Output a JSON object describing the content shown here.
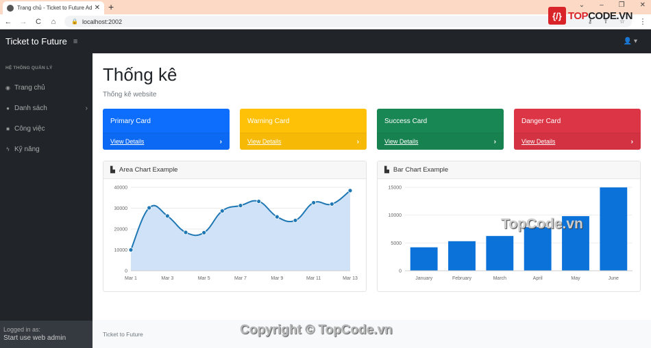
{
  "browser": {
    "tab_title": "Trang chủ - Ticket to Future Admin",
    "url": "localhost:2002",
    "nav": {
      "back": "←",
      "forward": "→",
      "reload": "C",
      "home": "⌂"
    },
    "window_controls": [
      "⌄",
      "–",
      "❐",
      "✕"
    ],
    "new_tab": "+",
    "close_tab": "✕",
    "watermark_logo": "{/}",
    "watermark_text_red": "TOP",
    "watermark_text": "CODE.VN"
  },
  "topnav": {
    "brand": "Ticket to Future",
    "menu_icon": "≡",
    "user_icon": "👤 ▾"
  },
  "sidebar": {
    "heading": "HỆ THỐNG QUẢN LÝ",
    "items": [
      {
        "label": "Trang chủ",
        "icon": "◉",
        "icon_name": "dashboard-icon"
      },
      {
        "label": "Danh sách",
        "icon": "●",
        "icon_name": "user-icon",
        "chevron": "›"
      },
      {
        "label": "Công việc",
        "icon": "■",
        "icon_name": "briefcase-icon"
      },
      {
        "label": "Kỹ năng",
        "icon": "ϟ",
        "icon_name": "bolt-icon"
      }
    ],
    "footer": {
      "label": "Logged in as:",
      "name": "Start use web admin"
    }
  },
  "page": {
    "title": "Thống kê",
    "subtitle": "Thống kê website"
  },
  "cards": [
    {
      "title": "Primary Card",
      "link": "View Details",
      "color": "#0d6efd"
    },
    {
      "title": "Warning Card",
      "link": "View Details",
      "color": "#ffc107"
    },
    {
      "title": "Success Card",
      "link": "View Details",
      "color": "#198754"
    },
    {
      "title": "Danger Card",
      "link": "View Details",
      "color": "#dc3545"
    }
  ],
  "chart_data": [
    {
      "type": "area",
      "title": "Area Chart Example",
      "x": [
        "Mar 1",
        "Mar 2",
        "Mar 3",
        "Mar 4",
        "Mar 5",
        "Mar 6",
        "Mar 7",
        "Mar 8",
        "Mar 9",
        "Mar 10",
        "Mar 11",
        "Mar 12",
        "Mar 13"
      ],
      "x_tick_labels": [
        "Mar 1",
        "Mar 3",
        "Mar 5",
        "Mar 7",
        "Mar 9",
        "Mar 11",
        "Mar 13"
      ],
      "values": [
        10000,
        30162,
        26263,
        18394,
        18287,
        28682,
        31274,
        33259,
        25849,
        24159,
        32651,
        31984,
        38451
      ],
      "y_ticks": [
        0,
        10000,
        20000,
        30000,
        40000
      ],
      "ylim": [
        0,
        40000
      ],
      "grid": true,
      "line_color": "#1f77b4",
      "fill_color": "#cfe2f7"
    },
    {
      "type": "bar",
      "title": "Bar Chart Example",
      "categories": [
        "January",
        "February",
        "March",
        "April",
        "May",
        "June"
      ],
      "values": [
        4215,
        5312,
        6251,
        7841,
        9821,
        14984
      ],
      "y_ticks": [
        0,
        5000,
        10000,
        15000
      ],
      "ylim": [
        0,
        15000
      ],
      "grid": true,
      "bar_color": "#0b72d9",
      "watermark": "TopCode.vn"
    }
  ],
  "footer": {
    "text": "Ticket to Future",
    "copyright": "Copyright © TopCode.vn"
  }
}
